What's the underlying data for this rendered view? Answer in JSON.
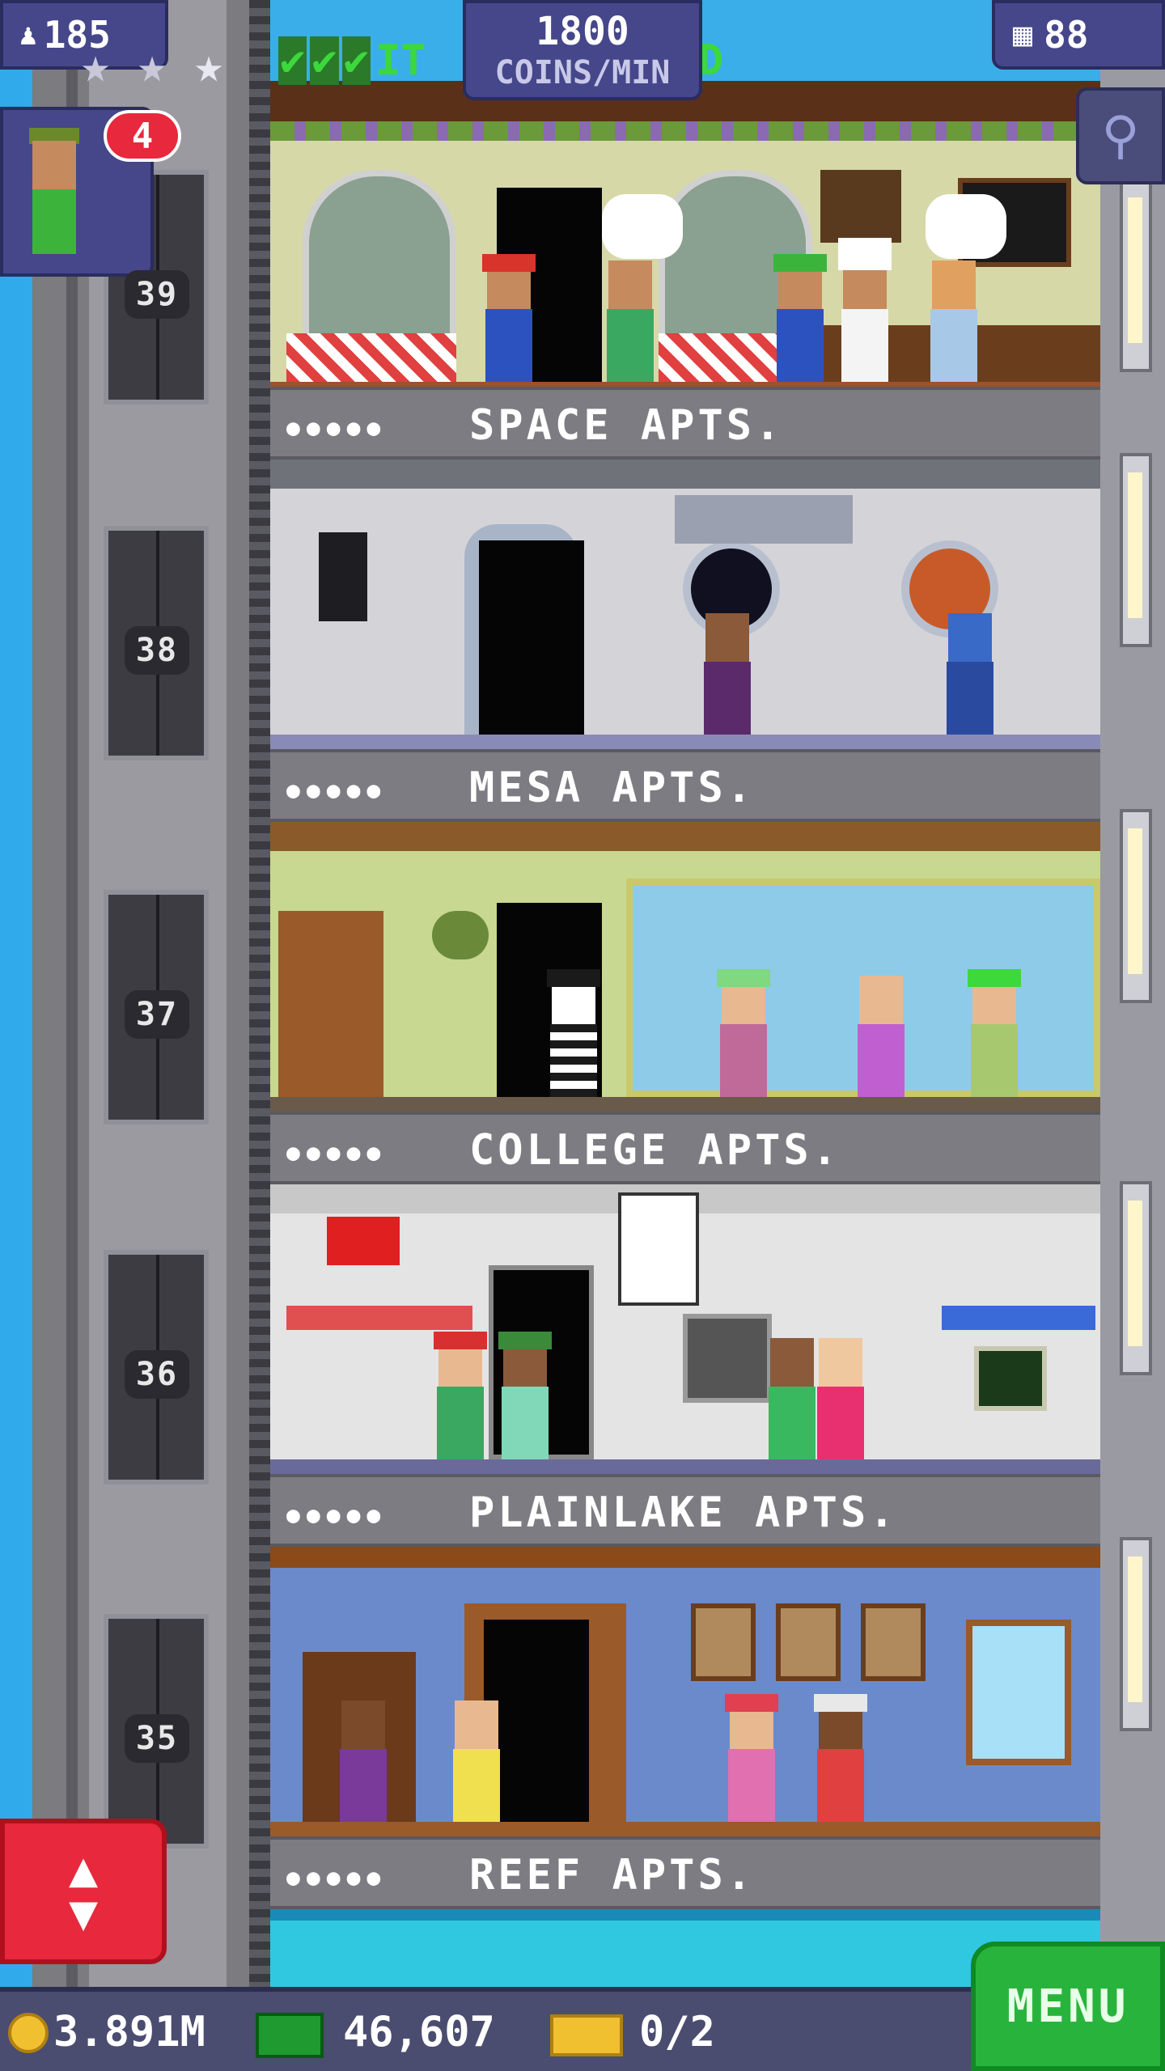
{
  "hud": {
    "population": "185",
    "coins_per_min_value": "1800",
    "coins_per_min_label": "COINS/MIN",
    "tasks_fragment_left": "IT",
    "tasks_fragment_right": "D",
    "floors_count": "88",
    "notification_count": "4"
  },
  "floors": [
    {
      "number": "39",
      "name": "SPACE APTS.",
      "dots": "●●●●●"
    },
    {
      "number": "38",
      "name": "MESA APTS.",
      "dots": "●●●●●"
    },
    {
      "number": "37",
      "name": "COLLEGE APTS.",
      "dots": "●●●●●"
    },
    {
      "number": "36",
      "name": "PLAINLAKE APTS.",
      "dots": "●●●●●"
    },
    {
      "number": "35",
      "name": "REEF APTS.",
      "dots": "●●●●●"
    }
  ],
  "bottom_bar": {
    "coins": "3.891M",
    "bux": "46,607",
    "tickets": "0/2",
    "menu_label": "MENU"
  },
  "colors": {
    "accent_red": "#e8283c",
    "menu_green": "#28b43c",
    "hud_purple": "#45478a"
  },
  "icons": {
    "population": "person-icon",
    "floors": "building-icon",
    "search": "magnifier-icon",
    "elevator": "up-down-arrows-icon",
    "coin": "coin-icon",
    "bux": "banknote-icon",
    "ticket": "ticket-icon"
  }
}
